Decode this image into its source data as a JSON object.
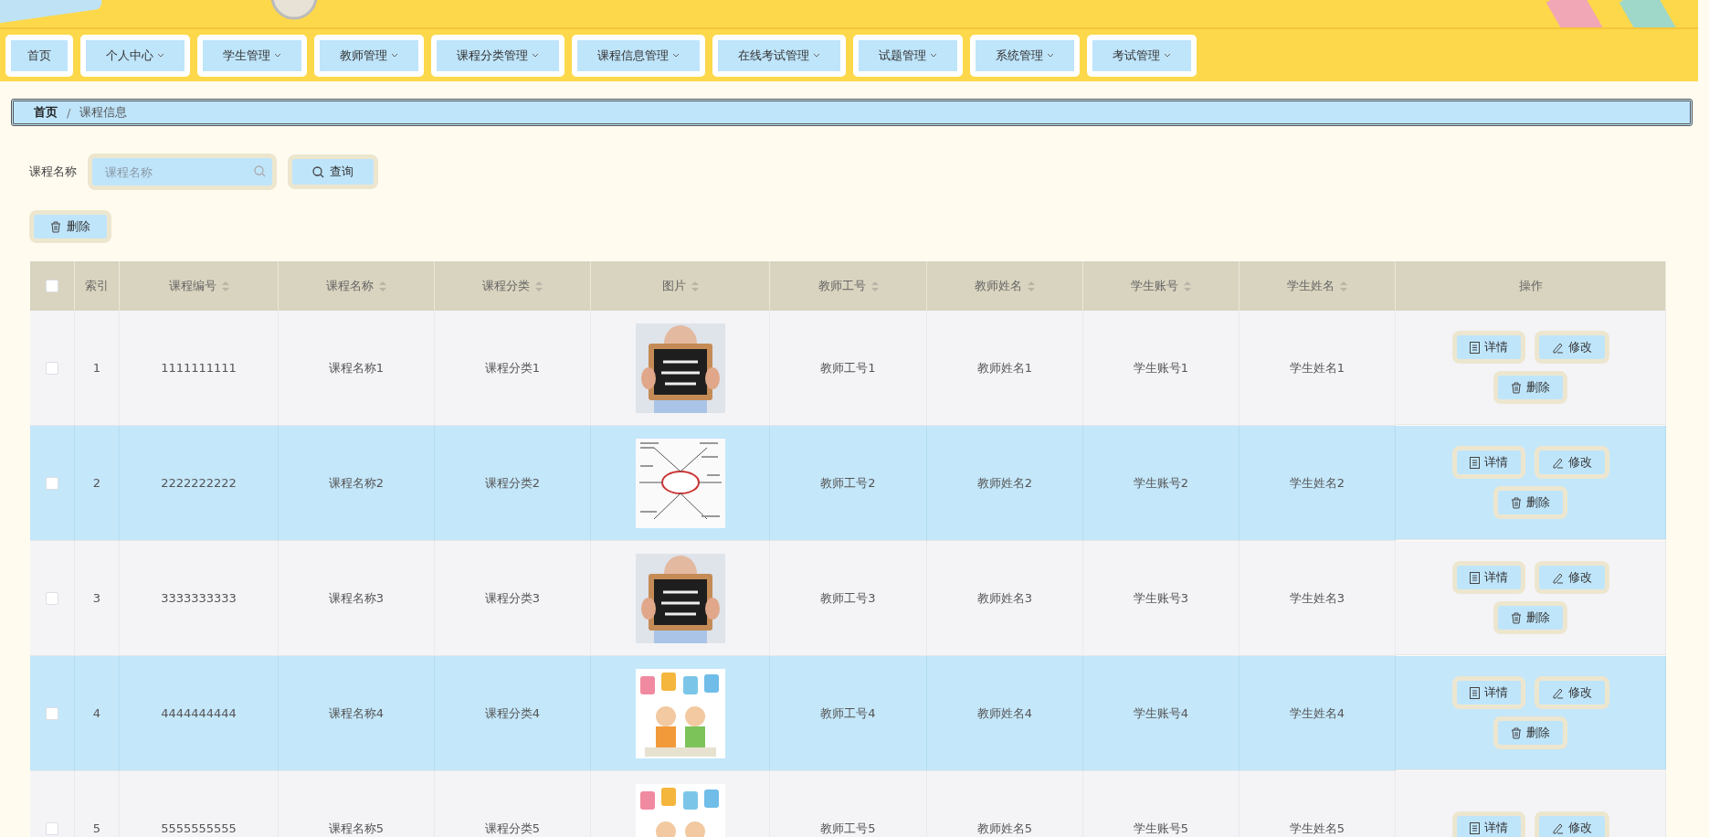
{
  "nav": [
    {
      "label": "首页",
      "dropdown": false
    },
    {
      "label": "个人中心",
      "dropdown": true
    },
    {
      "label": "学生管理",
      "dropdown": true
    },
    {
      "label": "教师管理",
      "dropdown": true
    },
    {
      "label": "课程分类管理",
      "dropdown": true
    },
    {
      "label": "课程信息管理",
      "dropdown": true
    },
    {
      "label": "在线考试管理",
      "dropdown": true
    },
    {
      "label": "试题管理",
      "dropdown": true
    },
    {
      "label": "系统管理",
      "dropdown": true
    },
    {
      "label": "考试管理",
      "dropdown": true
    }
  ],
  "breadcrumb": [
    "首页",
    "课程信息"
  ],
  "breadcrumb_separator": "/",
  "search": {
    "label": "课程名称",
    "placeholder": "课程名称",
    "button": "查询"
  },
  "delete_button": "删除",
  "table": {
    "select_all_checked": false,
    "columns": [
      {
        "label": "索引",
        "sortable": false
      },
      {
        "label": "课程编号",
        "sortable": true
      },
      {
        "label": "课程名称",
        "sortable": true
      },
      {
        "label": "课程分类",
        "sortable": true
      },
      {
        "label": "图片",
        "sortable": true
      },
      {
        "label": "教师工号",
        "sortable": true
      },
      {
        "label": "教师姓名",
        "sortable": true
      },
      {
        "label": "学生账号",
        "sortable": true
      },
      {
        "label": "学生姓名",
        "sortable": true
      },
      {
        "label": "操作",
        "sortable": false
      }
    ],
    "rows": [
      {
        "checked": false,
        "cells": [
          "1",
          "1111111111",
          "课程名称1",
          "课程分类1",
          "",
          "教师工号1",
          "教师姓名1",
          "学生账号1",
          "学生姓名1"
        ],
        "image": {
          "kind": "picture"
        },
        "actions": [
          {
            "kind": "detail",
            "label": "详情"
          },
          {
            "kind": "edit",
            "label": "修改"
          },
          {
            "kind": "delete",
            "label": "删除"
          }
        ]
      },
      {
        "checked": false,
        "cells": [
          "2",
          "2222222222",
          "课程名称2",
          "课程分类2",
          "",
          "教师工号2",
          "教师姓名2",
          "学生账号2",
          "学生姓名2"
        ],
        "image": {
          "kind": "picture"
        },
        "actions": [
          {
            "kind": "detail",
            "label": "详情"
          },
          {
            "kind": "edit",
            "label": "修改"
          },
          {
            "kind": "delete",
            "label": "删除"
          }
        ]
      },
      {
        "checked": false,
        "cells": [
          "3",
          "3333333333",
          "课程名称3",
          "课程分类3",
          "",
          "教师工号3",
          "教师姓名3",
          "学生账号3",
          "学生姓名3"
        ],
        "image": {
          "kind": "picture"
        },
        "actions": [
          {
            "kind": "detail",
            "label": "详情"
          },
          {
            "kind": "edit",
            "label": "修改"
          },
          {
            "kind": "delete",
            "label": "删除"
          }
        ]
      },
      {
        "checked": false,
        "cells": [
          "4",
          "4444444444",
          "课程名称4",
          "课程分类4",
          "",
          "教师工号4",
          "教师姓名4",
          "学生账号4",
          "学生姓名4"
        ],
        "image": {
          "kind": "picture"
        },
        "actions": [
          {
            "kind": "detail",
            "label": "详情"
          },
          {
            "kind": "edit",
            "label": "修改"
          },
          {
            "kind": "delete",
            "label": "删除"
          }
        ]
      },
      {
        "checked": false,
        "cells": [
          "5",
          "5555555555",
          "课程名称5",
          "课程分类5",
          "",
          "教师工号5",
          "教师姓名5",
          "学生账号5",
          "学生姓名5"
        ],
        "image": {
          "kind": "picture"
        },
        "actions": [
          {
            "kind": "detail",
            "label": "详情"
          },
          {
            "kind": "edit",
            "label": "修改"
          }
        ]
      }
    ]
  }
}
